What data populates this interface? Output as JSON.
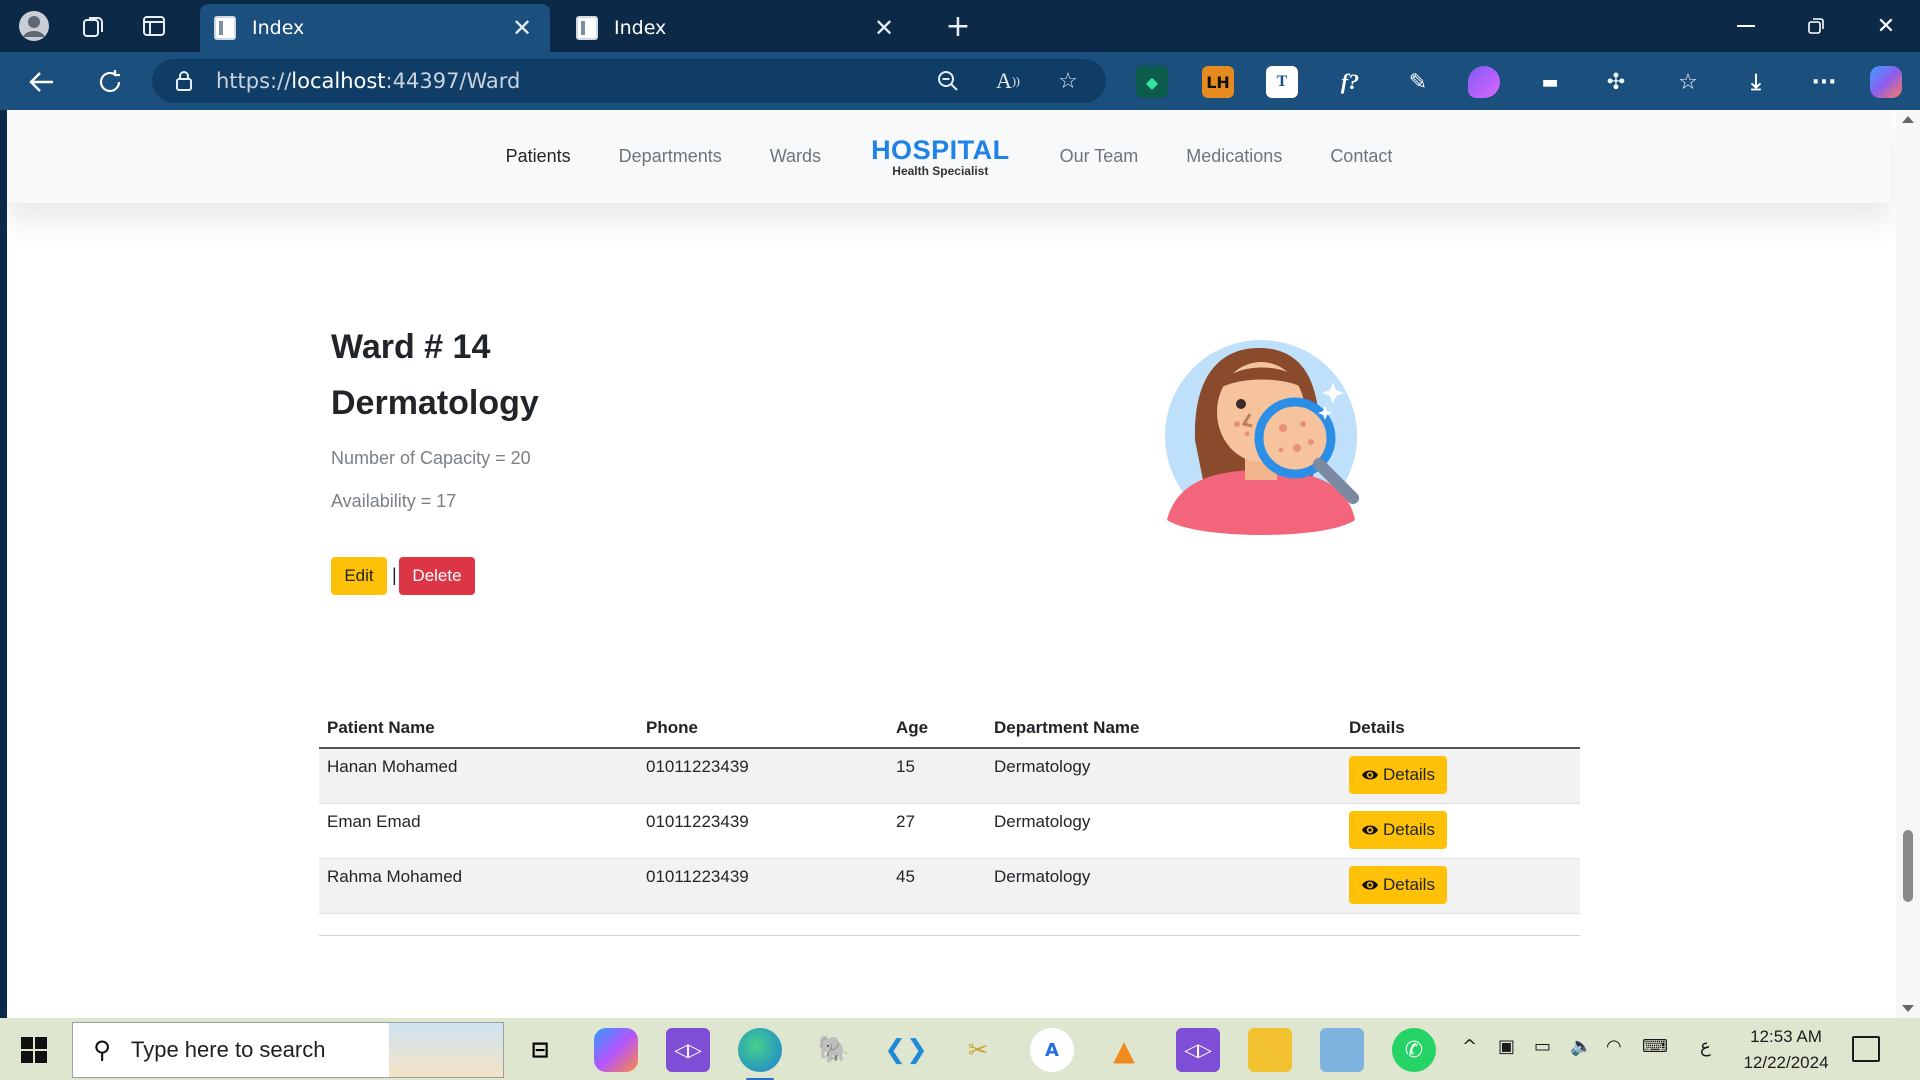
{
  "browser": {
    "tabs": [
      {
        "title": "Index",
        "active": true
      },
      {
        "title": "Index",
        "active": false
      }
    ],
    "url": {
      "scheme": "https://",
      "host": "localhost",
      "rest": ":44397/Ward"
    }
  },
  "site": {
    "nav": {
      "left": [
        "Patients",
        "Departments",
        "Wards"
      ],
      "brand_title": "HOSPITAL",
      "brand_sub": "Health Specialist",
      "right": [
        "Our Team",
        "Medications",
        "Contact"
      ]
    }
  },
  "ward": {
    "title": "Ward # 14",
    "department": "Dermatology",
    "capacity": "Number of Capacity = 20",
    "availability": "Availability = 17",
    "edit_label": "Edit",
    "separator": "|",
    "delete_label": "Delete"
  },
  "table": {
    "headers": [
      "Patient Name",
      "Phone",
      "Age",
      "Department Name",
      "Details"
    ],
    "rows": [
      {
        "name": "Hanan Mohamed",
        "phone": "01011223439",
        "age": "15",
        "department": "Dermatology",
        "details": "Details"
      },
      {
        "name": "Eman Emad",
        "phone": "01011223439",
        "age": "27",
        "department": "Dermatology",
        "details": "Details"
      },
      {
        "name": "Rahma Mohamed",
        "phone": "01011223439",
        "age": "45",
        "department": "Dermatology",
        "details": "Details"
      }
    ]
  },
  "taskbar": {
    "search_placeholder": "Type here to search",
    "time": "12:53 AM",
    "date": "12/22/2024",
    "lang": "ع"
  },
  "colors": {
    "brand": "#1e82e6",
    "edit": "#ffc107",
    "delete": "#dc3545",
    "chrome": "#1b4f7d"
  }
}
